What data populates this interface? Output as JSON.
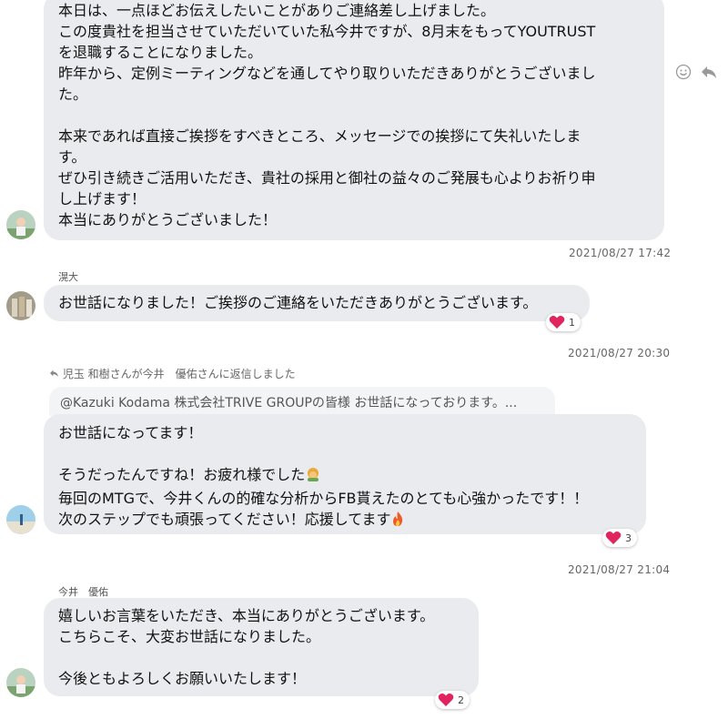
{
  "messages": [
    {
      "lines": [
        "本日は、一点ほどお伝えしたいことがありご連絡差し上げました。",
        "この度貴社を担当させていただいていた私今井ですが、8月末をもってYOUTRUST",
        "を退職することになりました。",
        "昨年から、定例ミーティングなどを通してやり取りいただきありがとうございまし",
        "た。",
        "",
        "本来であれば直接ご挨拶をすべきところ、メッセージでの挨拶にて失礼いたしま",
        "す。",
        "ぜひ引き続きご活用いただき、貴社の採用と御社の益々のご発展も心よりお祈り申",
        "し上げます！",
        "本当にありがとうございました！"
      ],
      "timestamp": "2021/08/27 17:42"
    },
    {
      "sender": "滉大",
      "lines": [
        "お世話になりました！ご挨拶のご連絡をいただきありがとうございます。"
      ],
      "reaction_count": "1",
      "timestamp": "2021/08/27 20:30"
    },
    {
      "reply_notice": "児玉 和樹さんが今井　優佑さんに返信しました",
      "quoted": "@Kazuki Kodama 株式会社TRIVE GROUPの皆様 お世話になっております。...",
      "lines": [
        "お世話になってます！",
        "",
        "そうだったんですね！お疲れ様でした",
        "毎回のMTGで、今井くんの的確な分析からFB貰えたのとても心強かったです！！",
        "次のステップでも頑張ってください！応援してます"
      ],
      "reaction_count": "3",
      "timestamp": "2021/08/27 21:04"
    },
    {
      "sender": "今井　優佑",
      "lines": [
        "嬉しいお言葉をいただき、本当にありがとうございます。",
        "こちらこそ、大変お世話になりました。",
        "",
        "今後ともよろしくお願いいたします！"
      ],
      "reaction_count": "2"
    }
  ],
  "icons": [
    "smiley-icon",
    "reply-arrow-icon",
    "heart-icon",
    "bow-emoji",
    "fire-emoji"
  ],
  "colors": {
    "bubble": "#e9ebee",
    "heart": "#e0245e",
    "background": "#ffffff"
  }
}
